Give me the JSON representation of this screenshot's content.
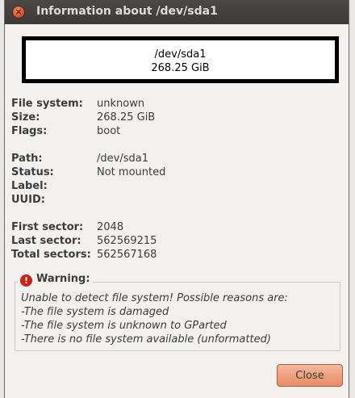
{
  "window": {
    "title": "Information about /dev/sda1"
  },
  "partition": {
    "name": "/dev/sda1",
    "size": "268.25 GiB"
  },
  "fields": {
    "filesystem": {
      "label": "File system:",
      "value": "unknown"
    },
    "size": {
      "label": "Size:",
      "value": "268.25 GiB"
    },
    "flags": {
      "label": "Flags:",
      "value": "boot"
    },
    "path": {
      "label": "Path:",
      "value": "/dev/sda1"
    },
    "status": {
      "label": "Status:",
      "value": "Not mounted"
    },
    "label": {
      "label": "Label:",
      "value": ""
    },
    "uuid": {
      "label": "UUID:",
      "value": ""
    },
    "first_sector": {
      "label": "First sector:",
      "value": "2048"
    },
    "last_sector": {
      "label": "Last sector:",
      "value": "562569215"
    },
    "total_sectors": {
      "label": "Total sectors:",
      "value": "562567168"
    }
  },
  "warning": {
    "title": "Warning:",
    "lines": [
      "Unable to detect file system! Possible reasons are:",
      "-The file system is damaged",
      "-The file system is unknown to GParted",
      "-There is no file system available (unformatted)"
    ]
  },
  "buttons": {
    "close_label": "Close"
  },
  "icons": {
    "window_close": "close-icon",
    "warning": "warning-icon"
  },
  "colors": {
    "titlebar": "#3c3b37",
    "close_button": "#e8916b",
    "warning_icon": "#d01f16"
  }
}
